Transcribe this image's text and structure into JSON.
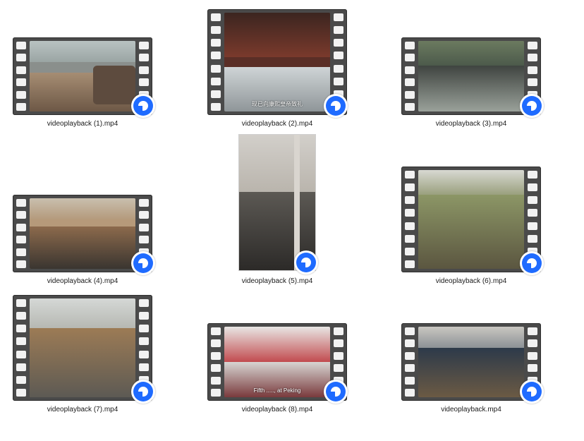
{
  "files": [
    {
      "name": "videoplayback (1).mp4",
      "icon": "video-file-icon",
      "subtitle": ""
    },
    {
      "name": "videoplayback (2).mp4",
      "icon": "video-file-icon",
      "subtitle": "现已向康熙皇帝致礼"
    },
    {
      "name": "videoplayback (3).mp4",
      "icon": "video-file-icon",
      "subtitle": ""
    },
    {
      "name": "videoplayback (4).mp4",
      "icon": "video-file-icon",
      "subtitle": ""
    },
    {
      "name": "videoplayback (5).mp4",
      "icon": "video-file-icon",
      "subtitle": ""
    },
    {
      "name": "videoplayback (6).mp4",
      "icon": "video-file-icon",
      "subtitle": ""
    },
    {
      "name": "videoplayback (7).mp4",
      "icon": "video-file-icon",
      "subtitle": ""
    },
    {
      "name": "videoplayback (8).mp4",
      "icon": "video-file-icon",
      "subtitle": "Fifth ....., at Peking"
    },
    {
      "name": "videoplayback.mp4",
      "icon": "video-file-icon",
      "subtitle": ""
    }
  ],
  "colors": {
    "film_strip": "#4a4a4a",
    "badge_accent": "#1f6bff",
    "label_text": "#1a1a1a",
    "background": "#ffffff"
  }
}
